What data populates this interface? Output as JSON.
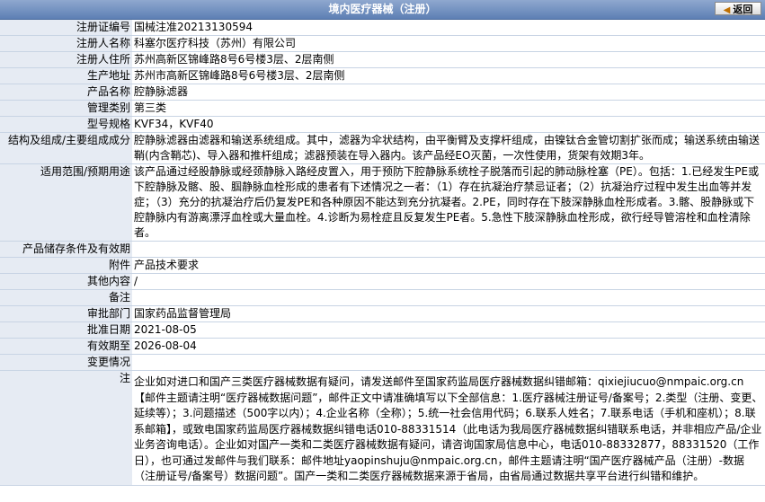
{
  "header": {
    "title": "境内医疗器械（注册）",
    "back_label": "返回"
  },
  "fields": [
    {
      "label": "注册证编号",
      "value": "国械注准20213130594"
    },
    {
      "label": "注册人名称",
      "value": "科塞尔医疗科技（苏州）有限公司"
    },
    {
      "label": "注册人住所",
      "value": "苏州高新区锦峰路8号6号楼3层、2层南侧"
    },
    {
      "label": "生产地址",
      "value": "苏州市高新区锦峰路8号6号楼3层、2层南侧"
    },
    {
      "label": "产品名称",
      "value": "腔静脉滤器"
    },
    {
      "label": "管理类别",
      "value": "第三类"
    },
    {
      "label": "型号规格",
      "value": "KVF34，KVF40"
    },
    {
      "label": "结构及组成/主要组成成分",
      "value": "腔静脉滤器由滤器和输送系统组成。其中，滤器为伞状结构，由平衡臂及支撑杆组成，由镍钛合金管切割扩张而成；输送系统由输送鞘(内含鞘芯)、导入器和推杆组成；滤器预装在导入器内。该产品经EO灭菌，一次性使用，货架有效期3年。"
    },
    {
      "label": "适用范围/预期用途",
      "value": "该产品通过经股静脉或经颈静脉入路经皮置入，用于预防下腔静脉系统栓子脱落而引起的肺动脉栓塞（PE）。包括：1.已经发生PE或下腔静脉及髂、股、腘静脉血栓形成的患者有下述情况之一者：（1）存在抗凝治疗禁忌证者；（2）抗凝治疗过程中发生出血等并发症；（3）充分的抗凝治疗后仍复发PE和各种原因不能达到充分抗凝者。2.PE，同时存在下肢深静脉血栓形成者。3.髂、股静脉或下腔静脉内有游离漂浮血栓或大量血栓。4.诊断为易栓症且反复发生PE者。5.急性下肢深静脉血栓形成，欲行经导管溶栓和血栓清除者。"
    },
    {
      "label": "产品储存条件及有效期",
      "value": ""
    },
    {
      "label": "附件",
      "value": "产品技术要求"
    },
    {
      "label": "其他内容",
      "value": "/"
    },
    {
      "label": "备注",
      "value": ""
    },
    {
      "label": "审批部门",
      "value": "国家药品监督管理局"
    },
    {
      "label": "批准日期",
      "value": "2021-08-05"
    },
    {
      "label": "有效期至",
      "value": "2026-08-04"
    },
    {
      "label": "变更情况",
      "value": ""
    }
  ],
  "note": {
    "label": "注",
    "value": "企业如对进口和国产三类医疗器械数据有疑问，请发送邮件至国家药监局医疗器械数据纠错邮箱：qixiejiucuo@nmpaic.org.cn【邮件主题请注明“医疗器械数据问题”，邮件正文中请准确填写以下全部信息：1.医疗器械注册证号/备案号；2.类型（注册、变更、延续等）；3.问题描述（500字以内）；4.企业名称（全称）；5.统一社会信用代码；6.联系人姓名；7.联系电话（手机和座机）；8.联系邮箱】，或致电国家药监局医疗器械数据纠错电话010-88331514（此电话为我局医疗器械数据纠错联系电话，并非相应产品/企业业务咨询电话）。企业如对国产一类和二类医疗器械数据有疑问，请咨询国家局信息中心，电话010-88332877，88331520（工作日），也可通过发邮件与我们联系：邮件地址yaopinshuju@nmpaic.org.cn，邮件主题请注明“国产医疗器械产品（注册）-数据（注册证号/备案号）数据问题”。国产一类和二类医疗器械数据来源于省局，由省局通过数据共享平台进行纠错和维护。"
  }
}
